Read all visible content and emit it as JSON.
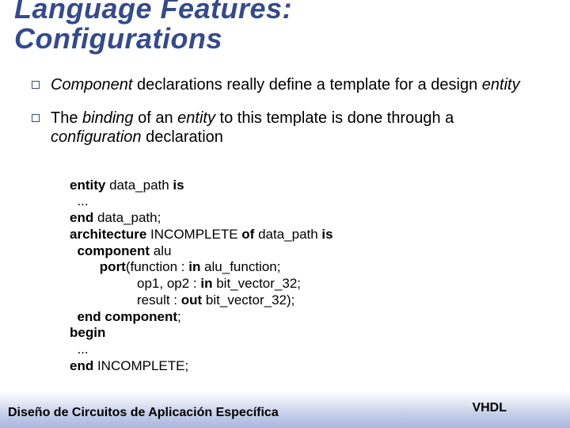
{
  "title_line1": "Language Features:",
  "title_line2": "Configurations",
  "bullets": [
    {
      "html": "<em>Component</em> declarations really define a template for a design <em>entity</em>"
    },
    {
      "html": "The <em>binding</em> of an <em>entity</em> to this template is done through a <em>configuration</em> declaration"
    }
  ],
  "code_lines": [
    "<b>entity</b> data_path <b>is</b>",
    "  ...",
    "<b>end</b> data_path;",
    "<b>architecture</b> INCOMPLETE <b>of</b> data_path <b>is</b>",
    "  <b>component</b> alu",
    "        <b>port</b>(function : <b>in</b> alu_function;",
    "                  op1, op2 : <b>in</b> bit_vector_32;",
    "                  result : <b>out</b> bit_vector_32);",
    "  <b>end component</b>;",
    "<b>begin</b>",
    "  ...",
    "<b>end</b> INCOMPLETE;"
  ],
  "footer": {
    "left": "Diseño de Circuitos de Aplicación Específica",
    "right": "VHDL"
  }
}
